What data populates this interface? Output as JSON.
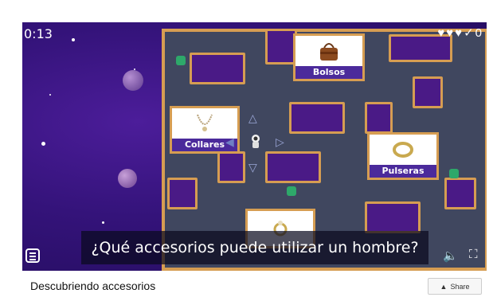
{
  "game": {
    "timer": "0:13",
    "score": "0",
    "lives": 3,
    "question": "¿Qué accesorios puede utilizar un hombre?",
    "answers": {
      "bolsos": "Bolsos",
      "collares": "Collares",
      "pulseras": "Pulseras",
      "rings": ""
    }
  },
  "footer": {
    "title": "Descubriendo accesorios",
    "share_label": "Share"
  },
  "icons": {
    "heart": "heart-icon",
    "check": "check-icon",
    "menu": "menu-icon",
    "volume": "volume-icon",
    "fullscreen": "fullscreen-icon",
    "player": "astronaut-icon",
    "enemy": "alien-icon"
  }
}
